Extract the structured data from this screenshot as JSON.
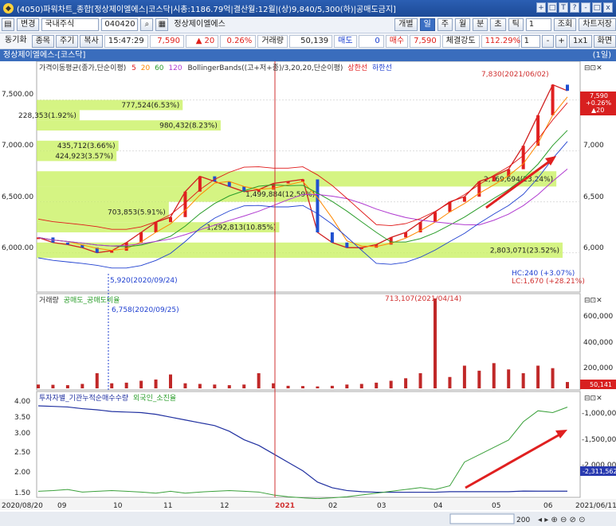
{
  "window": {
    "title": "(4050)파워차트_종합[정상제이엘에스|코스닥|시총:1186.79억|결산월:12월|(상)9,840/5,300(하)|공매도금지]",
    "buttons": [
      "+",
      "□",
      "T",
      "?",
      "0",
      "?",
      "-",
      "□",
      "x"
    ]
  },
  "toolbar1": {
    "change_label": "변경",
    "market": "국내주식",
    "code": "040420",
    "stock_name": "정상제이엘에스",
    "period_buttons": [
      "개별",
      "일",
      "주",
      "월",
      "분",
      "초",
      "틱"
    ],
    "tick_value": "1",
    "lookup_button": "조회",
    "save_button": "차트저장"
  },
  "toolbar2": {
    "sync_label": "동기화",
    "tabs": [
      "종목",
      "주기",
      "복사"
    ],
    "time": "15:47:29",
    "price": "7,590",
    "change": "▲ 20",
    "change_rate": "0.26%",
    "volume_label": "거래량",
    "volume": "50,139",
    "ask_label": "매도",
    "ask_value": "0",
    "bid_label": "매수",
    "bid_value": "7,590",
    "strength_label": "체결강도",
    "strength_value": "112.29%",
    "count": "1",
    "zoom_label": "1x1",
    "screen_label": "화면"
  },
  "chart_header": {
    "title": "정상제이엘에스-[코스닥]",
    "period": "(1일)"
  },
  "legends": {
    "price": "가격이동평균(종가,단순이평)",
    "ma_periods": [
      "5",
      "20",
      "60",
      "120"
    ],
    "bollinger": "BollingerBands((고+저+종)/3,20,20,단순이평)",
    "upper": "상한선",
    "lower": "하한선",
    "volume": "거래량",
    "short_sale": "공매도_공매도비율",
    "investor": "투자자별_기관누적순매수수량",
    "foreign": "외국인_소진율"
  },
  "annotations": {
    "high": "7,830(2021/06/02)",
    "low": "5,920(2020/09/24)",
    "low_vol": "6,758(2020/09/25)",
    "vol_peak": "713,107(2021/04/14)",
    "hc": "HC:240 (+3.07%)",
    "lc": "LC:1,670 (+28.21%)",
    "price_badge": [
      "7,590",
      "+0.26%",
      "▲20"
    ],
    "vol_badge": "50,141",
    "inv_badge": "-2,311,562"
  },
  "chart_data": {
    "type": "line",
    "title": "정상제이엘에스-[코스닥]",
    "x_range": [
      "2020/08/20",
      "2021/06/11"
    ],
    "x_ticks": [
      "2020/08/20",
      "09",
      "10",
      "11",
      "12",
      "2021",
      "02",
      "03",
      "04",
      "05",
      "06",
      "2021/06/11"
    ],
    "price_axis": {
      "ylim": [
        5800,
        8000
      ],
      "ticks": [
        "6,000.00",
        "6,500.00",
        "7,000.00",
        "7,500.00"
      ],
      "right_ticks": [
        "6,000",
        "6,500",
        "7,000"
      ]
    },
    "volume_axis": {
      "ticks": [
        "200,000",
        "400,000",
        "600,000"
      ]
    },
    "investor_axis": {
      "left_ticks": [
        "1.50",
        "2.00",
        "2.50",
        "3.00",
        "3.50",
        "4.00"
      ],
      "right_ticks": [
        "-1,000,000",
        "-1,500,000",
        "-2,000,000"
      ]
    },
    "volume_profile": [
      {
        "label": "777,524(6.53%)",
        "price_low": 7400,
        "price_high": 7500
      },
      {
        "label": "228,353(1.92%)",
        "price_low": 7300,
        "price_high": 7400
      },
      {
        "label": "980,432(8.23%)",
        "price_low": 7200,
        "price_high": 7300
      },
      {
        "label": "435,712(3.66%)",
        "price_low": 7000,
        "price_high": 7100
      },
      {
        "label": "424,923(3.57%)",
        "price_low": 6900,
        "price_high": 7000
      },
      {
        "label": "2,769,694(23.24%)",
        "price_low": 6650,
        "price_high": 6800
      },
      {
        "label": "1,499,884(12.59%)",
        "price_low": 6500,
        "price_high": 6650
      },
      {
        "label": "703,853(5.91%)",
        "price_low": 6300,
        "price_high": 6500
      },
      {
        "label": "1,292,813(10.85%)",
        "price_low": 6200,
        "price_high": 6300
      },
      {
        "label": "2,803,071(23.52%)",
        "price_low": 5950,
        "price_high": 6100
      }
    ],
    "series": [
      {
        "name": "종가",
        "values": [
          6150,
          6100,
          6080,
          6050,
          6000,
          6020,
          6100,
          6200,
          6300,
          6350,
          6600,
          6750,
          6700,
          6650,
          6600,
          6620,
          6680,
          6700,
          6720,
          6200,
          6100,
          6050,
          6050,
          6080,
          6150,
          6200,
          6300,
          6400,
          6500,
          6550,
          6700,
          6750,
          6820,
          7050,
          7350,
          7650,
          7590
        ]
      },
      {
        "name": "거래량",
        "values": [
          30000,
          28000,
          25000,
          35000,
          120000,
          40000,
          45000,
          60000,
          70000,
          110000,
          40000,
          35000,
          30000,
          25000,
          30000,
          120000,
          40000,
          20000,
          18000,
          15000,
          20000,
          30000,
          35000,
          45000,
          60000,
          80000,
          120000,
          713107,
          90000,
          180000,
          140000,
          200000,
          150000,
          120000,
          180000,
          160000,
          50141
        ]
      },
      {
        "name": "기관누적순매수",
        "values": [
          -800000,
          -810000,
          -820000,
          -850000,
          -870000,
          -900000,
          -910000,
          -920000,
          -950000,
          -1000000,
          -1050000,
          -1100000,
          -1150000,
          -1250000,
          -1400000,
          -1500000,
          -1650000,
          -1800000,
          -1950000,
          -2150000,
          -2250000,
          -2300000,
          -2320000,
          -2330000,
          -2330000,
          -2330000,
          -2330000,
          -2330000,
          -2320000,
          -2320000,
          -2320000,
          -2320000,
          -2320000,
          -2310000,
          -2311562,
          -2311562,
          -2311562
        ]
      },
      {
        "name": "외국인소진율",
        "values": [
          1.6,
          1.62,
          1.65,
          1.58,
          1.6,
          1.62,
          1.6,
          1.58,
          1.55,
          1.6,
          1.55,
          1.58,
          1.6,
          1.62,
          1.6,
          1.58,
          1.5,
          1.45,
          1.42,
          1.4,
          1.42,
          1.45,
          1.5,
          1.55,
          1.6,
          1.65,
          1.7,
          1.65,
          1.75,
          2.4,
          2.6,
          2.8,
          3.0,
          3.5,
          3.8,
          3.75,
          3.9
        ]
      }
    ]
  }
}
